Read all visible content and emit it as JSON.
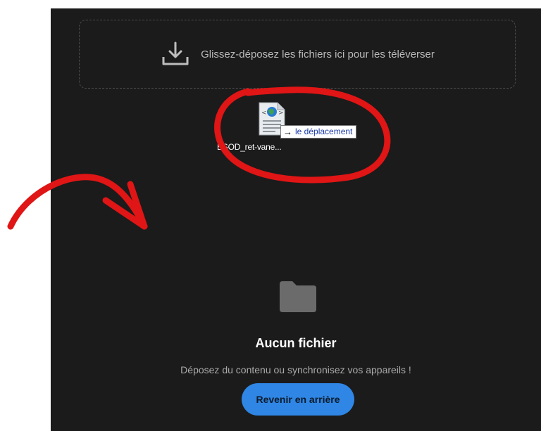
{
  "dropzone": {
    "icon": "download-tray-icon",
    "text": "Glissez-déposez les fichiers ici pour les téléverser"
  },
  "drag_preview": {
    "file_icon": "html-file-icon",
    "file_name": "BSOD_ret-vane...",
    "tooltip_icon": "arrow-right-icon",
    "tooltip_text": "le déplacement"
  },
  "empty_state": {
    "icon": "folder-icon",
    "title": "Aucun fichier",
    "subtitle": "Déposez du contenu ou synchronisez vos appareils !",
    "button_label": "Revenir en arrière"
  },
  "annotation": {
    "color": "#e01515",
    "shapes": [
      "circle-around-dragged-file",
      "curved-arrow-pointing-down-right"
    ]
  },
  "colors": {
    "panel_background": "#1b1b1b",
    "accent": "#2f86e4",
    "folder": "#6b6b6b"
  }
}
